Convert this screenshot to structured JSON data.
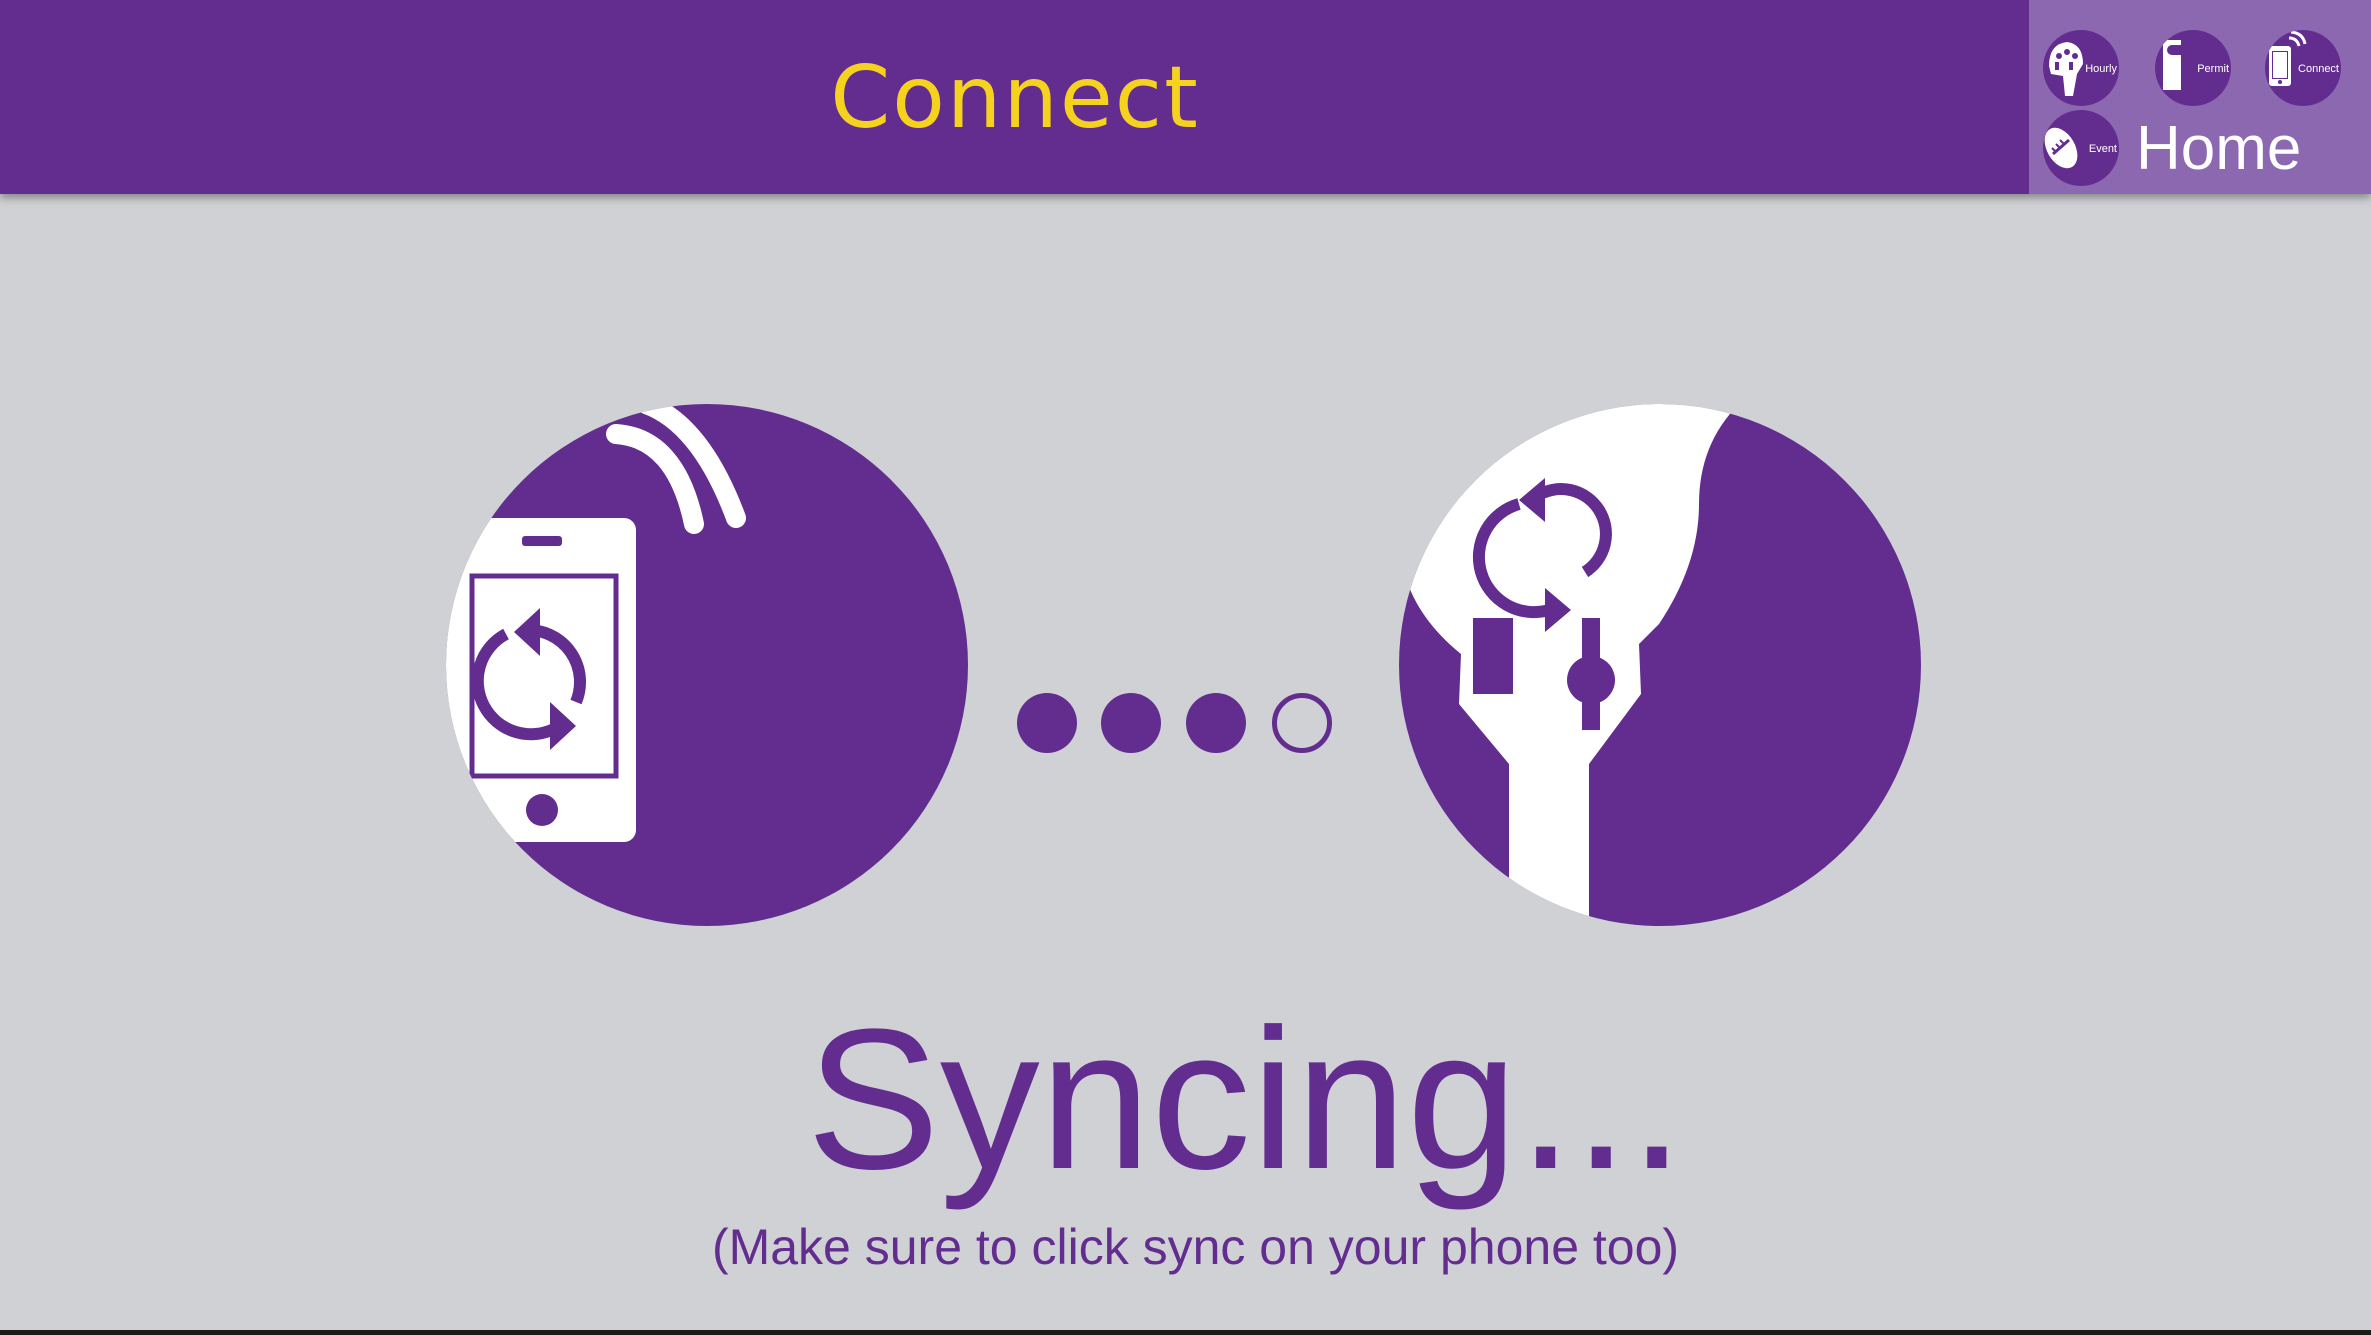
{
  "header": {
    "title": "Connect"
  },
  "nav": {
    "items": [
      {
        "label": "Hourly",
        "icon": "parking-meter-icon"
      },
      {
        "label": "Permit",
        "icon": "permit-tag-icon"
      },
      {
        "label": "Connect",
        "icon": "phone-signal-icon"
      },
      {
        "label": "Event",
        "icon": "football-icon"
      }
    ],
    "home_label": "Home"
  },
  "sync": {
    "status": "Syncing...",
    "hint": "(Make sure to click sync on your phone too)",
    "progress_steps_total": 4,
    "progress_steps_done": 3
  },
  "colors": {
    "brand": "#632d90",
    "accent": "#f5d21e",
    "panel": "#8c68b0",
    "background": "#d0d1d4"
  },
  "icons": {
    "phone": "phone-sync-icon",
    "meter": "meter-sync-icon"
  }
}
